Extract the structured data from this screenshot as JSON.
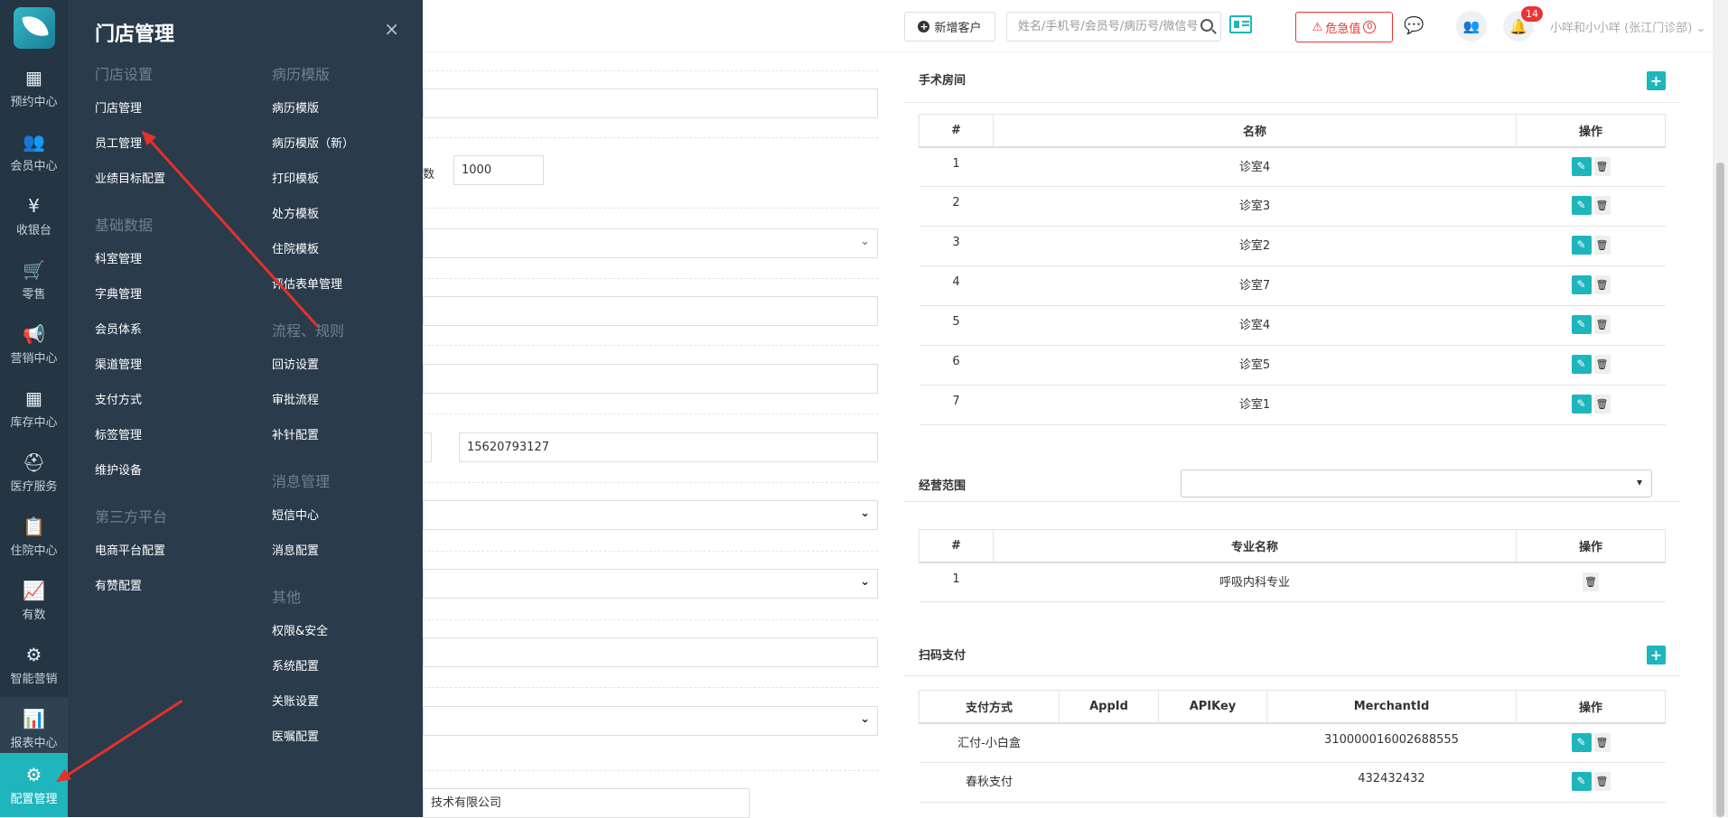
{
  "rail": {
    "items": [
      {
        "label": "预约中心",
        "icon": "calendar-icon",
        "glyph": "▦"
      },
      {
        "label": "会员中心",
        "icon": "members-icon",
        "glyph": "👥"
      },
      {
        "label": "收银台",
        "icon": "yen-icon",
        "glyph": "¥"
      },
      {
        "label": "零售",
        "icon": "cart-icon",
        "glyph": "🛒"
      },
      {
        "label": "营销中心",
        "icon": "megaphone-icon",
        "glyph": "📢"
      },
      {
        "label": "库存中心",
        "icon": "grid-icon",
        "glyph": "▦"
      },
      {
        "label": "医疗服务",
        "icon": "medkit-icon",
        "glyph": "⛑"
      },
      {
        "label": "住院中心",
        "icon": "clipboard-icon",
        "glyph": "📋"
      },
      {
        "label": "有数",
        "icon": "line-chart-icon",
        "glyph": "📈"
      },
      {
        "label": "智能营销",
        "icon": "smart-icon",
        "glyph": "⚙"
      },
      {
        "label": "报表中心",
        "icon": "bar-chart-icon",
        "glyph": "📊"
      }
    ],
    "active": {
      "label": "配置管理",
      "icon": "gear-icon",
      "glyph": "⚙"
    }
  },
  "flyout": {
    "title": "门店管理",
    "close": "×",
    "col1": [
      {
        "type": "section",
        "text": "门店设置"
      },
      {
        "type": "item",
        "text": "门店管理"
      },
      {
        "type": "item",
        "text": "员工管理"
      },
      {
        "type": "item",
        "text": "业绩目标配置"
      },
      {
        "type": "section",
        "text": "基础数据"
      },
      {
        "type": "item",
        "text": "科室管理"
      },
      {
        "type": "item",
        "text": "字典管理"
      },
      {
        "type": "item",
        "text": "会员体系"
      },
      {
        "type": "item",
        "text": "渠道管理"
      },
      {
        "type": "item",
        "text": "支付方式"
      },
      {
        "type": "item",
        "text": "标签管理"
      },
      {
        "type": "item",
        "text": "维护设备"
      },
      {
        "type": "section",
        "text": "第三方平台"
      },
      {
        "type": "item",
        "text": "电商平台配置"
      },
      {
        "type": "item",
        "text": "有赞配置"
      }
    ],
    "col2": [
      {
        "type": "section",
        "text": "病历模版"
      },
      {
        "type": "item",
        "text": "病历模版"
      },
      {
        "type": "item",
        "text": "病历模版（新）"
      },
      {
        "type": "item",
        "text": "打印模板"
      },
      {
        "type": "item",
        "text": "处方模板"
      },
      {
        "type": "item",
        "text": "住院模板"
      },
      {
        "type": "item",
        "text": "评估表单管理"
      },
      {
        "type": "section",
        "text": "流程、规则"
      },
      {
        "type": "item",
        "text": "回访设置"
      },
      {
        "type": "item",
        "text": "审批流程"
      },
      {
        "type": "item",
        "text": "补针配置"
      },
      {
        "type": "section",
        "text": "消息管理"
      },
      {
        "type": "item",
        "text": "短信中心"
      },
      {
        "type": "item",
        "text": "消息配置"
      },
      {
        "type": "section",
        "text": "其他"
      },
      {
        "type": "item",
        "text": "权限&安全"
      },
      {
        "type": "item",
        "text": "系统配置"
      },
      {
        "type": "item",
        "text": "关账设置"
      },
      {
        "type": "item",
        "text": "医嘱配置"
      }
    ]
  },
  "topbar": {
    "new_customer": "新增客户",
    "search_placeholder": "姓名/手机号/会员号/病历号/微信号",
    "danger_label": "危急值",
    "danger_count": "0",
    "notification_count": "14",
    "user": "小咩和小小咩 (张江门诊部)"
  },
  "form": {
    "num_label": "数",
    "num_value": "1000",
    "phone_value": "15620793127",
    "company_value": "技术有限公司"
  },
  "surgery_rooms": {
    "title": "手术房间",
    "headers": [
      "#",
      "名称",
      "操作"
    ],
    "rows": [
      {
        "no": "1",
        "name": "诊室4"
      },
      {
        "no": "2",
        "name": "诊室3"
      },
      {
        "no": "3",
        "name": "诊室2"
      },
      {
        "no": "4",
        "name": "诊室7"
      },
      {
        "no": "5",
        "name": "诊室4"
      },
      {
        "no": "6",
        "name": "诊室5"
      },
      {
        "no": "7",
        "name": "诊室1"
      }
    ]
  },
  "business_scope": {
    "title": "经营范围",
    "headers": [
      "#",
      "专业名称",
      "操作"
    ],
    "rows": [
      {
        "no": "1",
        "name": "呼吸内科专业"
      }
    ]
  },
  "scan_pay": {
    "title": "扫码支付",
    "headers": [
      "支付方式",
      "AppId",
      "APIKey",
      "MerchantId",
      "操作"
    ],
    "rows": [
      {
        "method": "汇付-小白盒",
        "appid": "",
        "apikey": "",
        "merchant": "310000016002688555"
      },
      {
        "method": "春秋支付",
        "appid": "",
        "apikey": "",
        "merchant": "432432432"
      }
    ]
  },
  "colors": {
    "accent": "#1fb5bd",
    "danger": "#e33333",
    "arrow": "#e6302b",
    "sidebar": "#243543",
    "flyout": "#2a3b4c"
  }
}
